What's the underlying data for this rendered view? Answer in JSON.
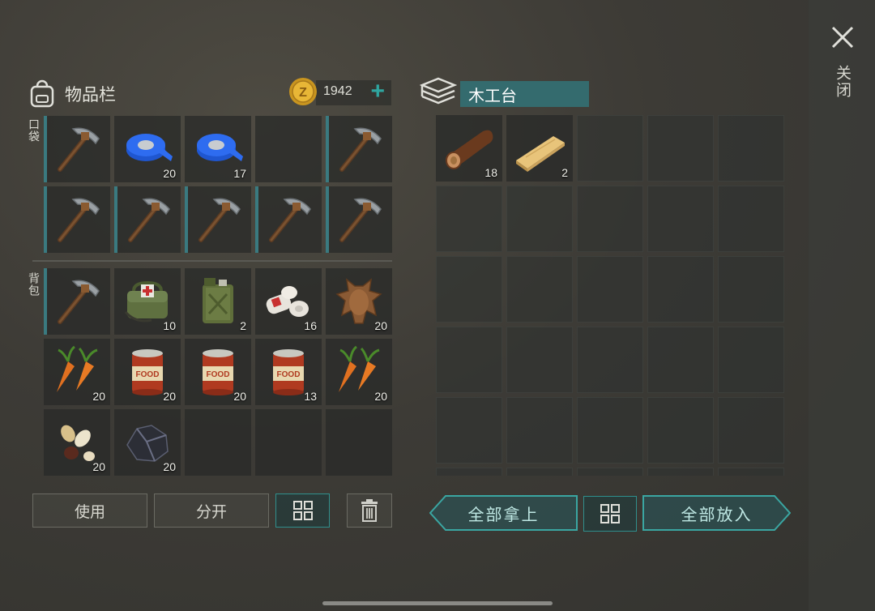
{
  "close_label": "关闭",
  "inventory": {
    "title": "物品栏",
    "coins": "1942",
    "plus": "+",
    "pocket_label": "口袋",
    "backpack_label": "背包",
    "pocket": [
      {
        "item": "pickaxe-icon",
        "qty": ""
      },
      {
        "item": "blue-tape-icon",
        "qty": "20"
      },
      {
        "item": "blue-tape-icon",
        "qty": "17"
      },
      {
        "item": "",
        "qty": ""
      },
      {
        "item": "pickaxe-icon",
        "qty": ""
      },
      {
        "item": "pickaxe-icon",
        "qty": ""
      },
      {
        "item": "pickaxe-icon",
        "qty": ""
      },
      {
        "item": "pickaxe-icon",
        "qty": ""
      },
      {
        "item": "pickaxe-icon",
        "qty": ""
      },
      {
        "item": "pickaxe-icon",
        "qty": ""
      }
    ],
    "backpack": [
      {
        "item": "pickaxe-icon",
        "qty": ""
      },
      {
        "item": "medkit-bag-icon",
        "qty": "10"
      },
      {
        "item": "jerrycan-icon",
        "qty": "2"
      },
      {
        "item": "bandage-icon",
        "qty": "16"
      },
      {
        "item": "leather-hide-icon",
        "qty": "20"
      },
      {
        "item": "carrot-icon",
        "qty": "20"
      },
      {
        "item": "food-can-icon",
        "qty": "20"
      },
      {
        "item": "food-can-icon",
        "qty": "20"
      },
      {
        "item": "food-can-icon",
        "qty": "13"
      },
      {
        "item": "carrot-icon",
        "qty": "20"
      },
      {
        "item": "seeds-icon",
        "qty": "20"
      },
      {
        "item": "coal-ore-icon",
        "qty": "20"
      },
      {
        "item": "",
        "qty": ""
      },
      {
        "item": "",
        "qty": ""
      },
      {
        "item": "",
        "qty": ""
      }
    ],
    "use_label": "使用",
    "split_label": "分开"
  },
  "crafting": {
    "title": "木工台",
    "slots": [
      {
        "item": "wood-log-icon",
        "qty": "18"
      },
      {
        "item": "wood-plank-icon",
        "qty": "2"
      }
    ],
    "take_all_label": "全部拿上",
    "put_all_label": "全部放入"
  },
  "colors": {
    "accent": "#2fa6a0",
    "title_bg": "#346b6e"
  }
}
